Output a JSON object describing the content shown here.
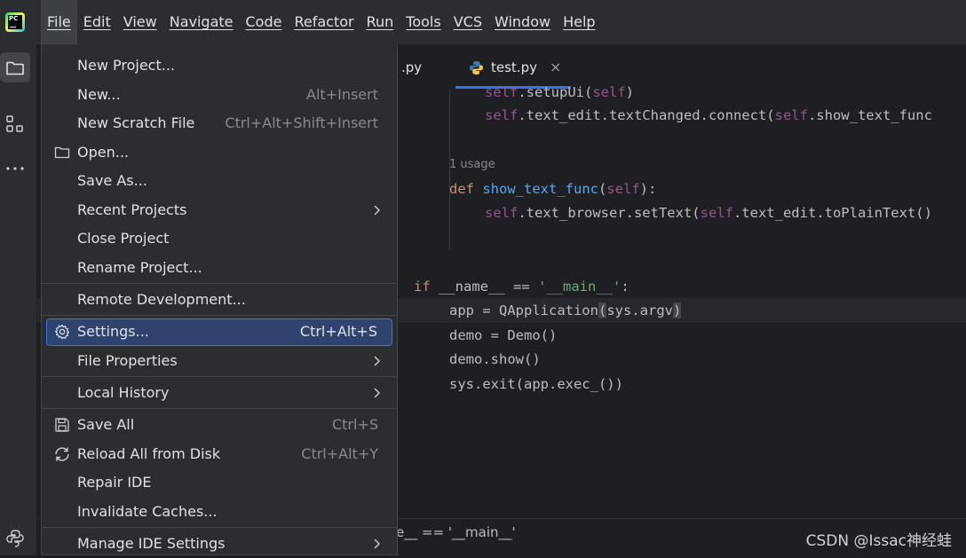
{
  "menubar": {
    "app_logo_text": "PC",
    "items": [
      {
        "label": "File"
      },
      {
        "label": "Edit"
      },
      {
        "label": "View"
      },
      {
        "label": "Navigate"
      },
      {
        "label": "Code"
      },
      {
        "label": "Refactor"
      },
      {
        "label": "Run"
      },
      {
        "label": "Tools"
      },
      {
        "label": "VCS"
      },
      {
        "label": "Window"
      },
      {
        "label": "Help"
      }
    ]
  },
  "toolstrip": {
    "icons": [
      "project-folder-icon",
      "structure-icon",
      "more-icon",
      "python-console-icon"
    ]
  },
  "tabs": {
    "partial_tab": ".py",
    "active_tab": "test.py",
    "close_glyph": "×"
  },
  "file_menu": {
    "items": [
      {
        "label": "New Project...",
        "shortcut": ""
      },
      {
        "label": "New...",
        "shortcut": "Alt+Insert"
      },
      {
        "label": "New Scratch File",
        "shortcut": "Ctrl+Alt+Shift+Insert"
      },
      {
        "label": "Open...",
        "shortcut": "",
        "icon": "folder-icon"
      },
      {
        "label": "Save As...",
        "shortcut": ""
      },
      {
        "label": "Recent Projects",
        "shortcut": "",
        "submenu": true
      },
      {
        "label": "Close Project",
        "shortcut": ""
      },
      {
        "label": "Rename Project...",
        "shortcut": ""
      },
      {
        "label": "Remote Development...",
        "shortcut": ""
      },
      {
        "label": "Settings...",
        "shortcut": "Ctrl+Alt+S",
        "icon": "gear-icon",
        "highlighted": true
      },
      {
        "label": "File Properties",
        "shortcut": "",
        "submenu": true
      },
      {
        "label": "Local History",
        "shortcut": "",
        "submenu": true
      },
      {
        "label": "Save All",
        "shortcut": "Ctrl+S",
        "icon": "save-icon"
      },
      {
        "label": "Reload All from Disk",
        "shortcut": "Ctrl+Alt+Y",
        "icon": "reload-icon"
      },
      {
        "label": "Repair IDE",
        "shortcut": ""
      },
      {
        "label": "Invalidate Caches...",
        "shortcut": ""
      },
      {
        "label": "Manage IDE Settings",
        "shortcut": "",
        "submenu": true
      }
    ]
  },
  "editor": {
    "usage_hint": "1 usage",
    "lines": {
      "l0_a": "self",
      "l0_b": ".setupUi(",
      "l0_c": "self",
      "l0_d": ")",
      "l1_a": "self",
      "l1_b": ".text_edit.textChanged.connect(",
      "l1_c": "self",
      "l1_d": ".show_text_func",
      "l2_kw": "def",
      "l2_fn": "show_text_func",
      "l2_p1": "(",
      "l2_self": "self",
      "l2_p2": "):",
      "l3_a": "self",
      "l3_b": ".text_browser.setText(",
      "l3_c": "self",
      "l3_d": ".text_edit.toPlainText()",
      "l4_kw": "if",
      "l4_mid": " __name__ == ",
      "l4_str": "'__main__'",
      "l4_end": ":",
      "l5_a": "app = QApplication",
      "l5_b": "(",
      "l5_c": "sys.argv",
      "l5_d": ")",
      "l6": "demo = Demo()",
      "l7": "demo.show()",
      "l8": "sys.exit(app.exec_())"
    }
  },
  "status": {
    "breadcrumb": "e__ == '__main__'",
    "watermark": "CSDN @Issac神经蛙"
  },
  "colors": {
    "accent": "#3574f0",
    "highlight_bg": "#2e436e",
    "menu_bg": "#2b2d30",
    "editor_bg": "#1e1f22"
  }
}
